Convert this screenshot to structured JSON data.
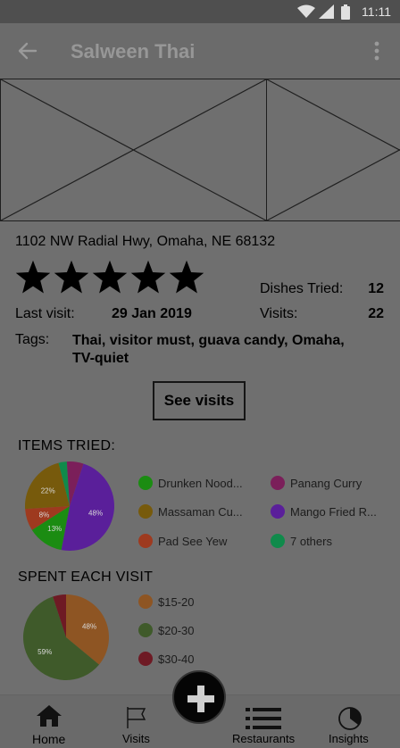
{
  "status_bar": {
    "time": "11:11"
  },
  "app_bar": {
    "title": "Salween Thai"
  },
  "restaurant": {
    "address": "1102 NW Radial Hwy, Omaha, NE 68132",
    "rating": 5,
    "last_visit_label": "Last visit:",
    "last_visit_value": "29 Jan 2019",
    "dishes_tried_label": "Dishes Tried:",
    "dishes_tried_value": "12",
    "visits_label": "Visits:",
    "visits_value": "22",
    "tags_label": "Tags:",
    "tags_value": "Thai, visitor must, guava candy, Omaha, TV-quiet",
    "see_visits_label": "See visits"
  },
  "items_tried": {
    "title": "ITEMS TRIED:",
    "slices": [
      {
        "label": "Mango Fried R...",
        "value": 48,
        "color": "#5a1f9a",
        "pct_label": "48%"
      },
      {
        "label": "Drunken Nood...",
        "value": 13,
        "color": "#1b8c12",
        "pct_label": "13%"
      },
      {
        "label": "Pad See Yew",
        "value": 8,
        "color": "#9e3a1f",
        "pct_label": "8%"
      },
      {
        "label": "Massaman Cu...",
        "value": 22,
        "color": "#775a0c",
        "pct_label": "22%"
      },
      {
        "label": "7 others",
        "value": 3,
        "color": "#108a4b",
        "pct_label": ""
      },
      {
        "label": "Panang Curry",
        "value": 6,
        "color": "#7b1f5a",
        "pct_label": ""
      }
    ],
    "legend": [
      {
        "label": "Drunken Nood...",
        "color": "#1b8c12"
      },
      {
        "label": "Panang Curry",
        "color": "#7b1f5a"
      },
      {
        "label": "Massaman Cu...",
        "color": "#775a0c"
      },
      {
        "label": "Mango Fried R...",
        "color": "#5a1f9a"
      },
      {
        "label": "Pad See Yew",
        "color": "#9e3a1f"
      },
      {
        "label": "7 others",
        "color": "#108a4b"
      }
    ]
  },
  "spent_each_visit": {
    "title": "SPENT EACH VISIT",
    "slices": [
      {
        "label": "$15-20",
        "value": 36,
        "color": "#8e5523",
        "pct_label": "48%"
      },
      {
        "label": "$20-30",
        "value": 59,
        "color": "#3f5a2a",
        "pct_label": "59%"
      },
      {
        "label": "$30-40",
        "value": 5,
        "color": "#6e1a24",
        "pct_label": ""
      }
    ],
    "legend": [
      {
        "label": "$15-20",
        "color": "#8e5523"
      },
      {
        "label": "$20-30",
        "color": "#3f5a2a"
      },
      {
        "label": "$30-40",
        "color": "#6e1a24"
      }
    ]
  },
  "bottom_nav": {
    "home": "Home",
    "visits": "Visits",
    "restaurants": "Restaurants",
    "insights": "Insights"
  },
  "colors": {
    "overlay_background": "#6f6f6f",
    "app_bar": "#6b6b6b",
    "status_bar": "#4f4f4f",
    "fab": "#050505"
  }
}
